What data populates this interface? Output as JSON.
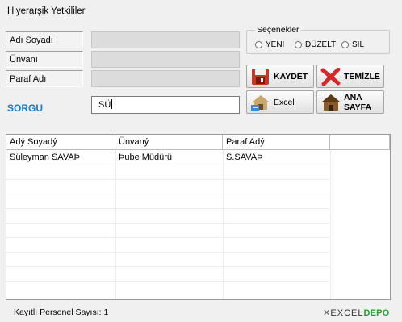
{
  "window": {
    "title": "Hiyerarşik Yetkililer"
  },
  "form": {
    "fields": [
      {
        "label": "Adı Soyadı"
      },
      {
        "label": "Ünvanı"
      },
      {
        "label": "Paraf Adı"
      }
    ],
    "query_label": "SORGU",
    "query_value": "SÜ"
  },
  "options": {
    "legend": "Seçenekler",
    "radios": [
      "YENİ",
      "DÜZELT",
      "SİL"
    ]
  },
  "buttons": {
    "save": "KAYDET",
    "clear": "TEMİZLE",
    "excel": "Excel",
    "home": "ANA SAYFA"
  },
  "grid": {
    "columns": [
      "Adý Soyadý",
      "Ünvaný",
      "Paraf Adý",
      ""
    ],
    "rows": [
      [
        "Süleyman SAVAÞ",
        "Þube Müdürü",
        "S.SAVAÞ"
      ]
    ]
  },
  "status": {
    "text": "Kayıtlı Personel Sayısı:  1"
  },
  "logo": {
    "part1": "EXCEL",
    "part2": "DEPO"
  },
  "colors": {
    "accent": "#1f7bc1",
    "save_icon": "#c0392b",
    "clear_icon": "#d12a2a"
  }
}
